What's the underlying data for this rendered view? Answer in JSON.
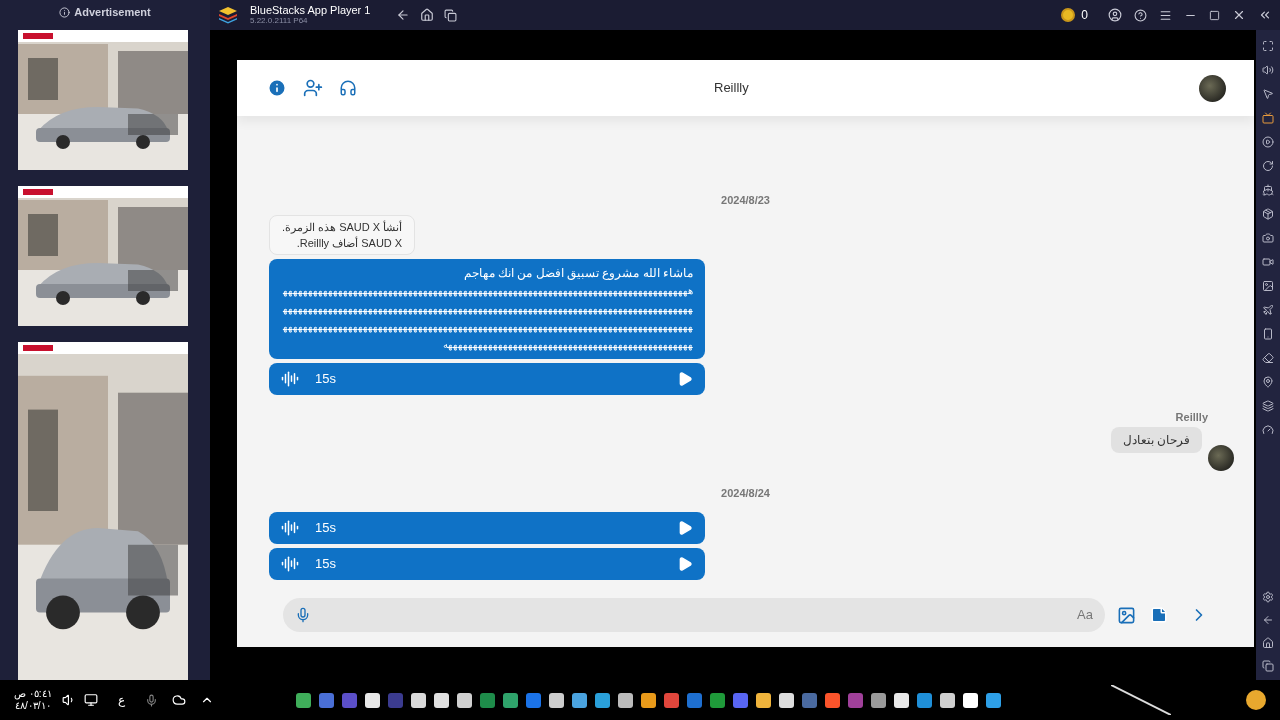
{
  "window": {
    "title": "BlueStacks App Player 1",
    "version": "5.22.0.2111 P64",
    "coins": "0"
  },
  "ads": {
    "label": "Advertisement"
  },
  "chat": {
    "title": "Reillly",
    "composer": {
      "placeholder": "Aa"
    },
    "items": [
      {
        "kind": "date",
        "text": "2024/8/23"
      },
      {
        "kind": "notice",
        "lines": [
          "أنشأ SAUD X هذه الزمرة.",
          "SAUD X أضاف Reillly."
        ]
      },
      {
        "kind": "text",
        "lines": [
          "ماشاء الله مشروع تسبيق افضل من انك مهاجم",
          "هههههههههههههههههههههههههههههههههههههههههههههههههههههههههههههههههههههههههههههههههههههههههههههههههههههههههههههههههههههههههههههههههههههههههههههههههههههههههههههههههههههههههههههههههههههههههههههههههههههههههههههههههههههههههههههههههههههههههههههههههههههههههههههههههههههههههههههههههههههههههههههههههههههههه"
        ]
      },
      {
        "kind": "audio",
        "duration": "15s"
      },
      {
        "kind": "incoming",
        "sender": "Reillly",
        "text": "فرحان بتعادل"
      },
      {
        "kind": "date",
        "text": "2024/8/24"
      },
      {
        "kind": "audio",
        "duration": "15s"
      },
      {
        "kind": "audio",
        "duration": "15s"
      }
    ]
  },
  "taskbar": {
    "time": "٠٥:٤١ ص",
    "date": "٤٨/٠٣/١٠",
    "language": "ع"
  }
}
